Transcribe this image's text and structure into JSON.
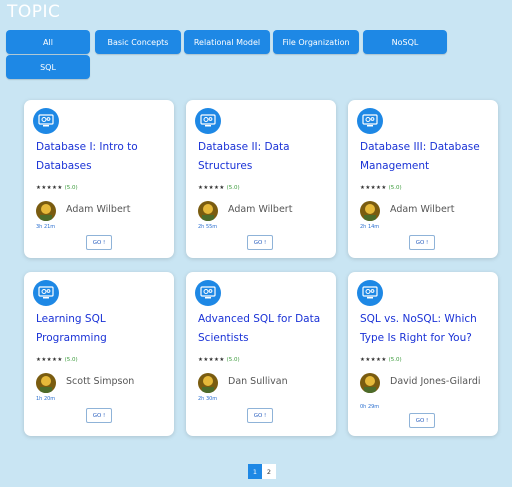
{
  "header": {
    "title": "TOPIC"
  },
  "filters": [
    {
      "label": "All"
    },
    {
      "label": "Basic Concepts"
    },
    {
      "label": "Relational Model"
    },
    {
      "label": "File Organization"
    },
    {
      "label": "NoSQL"
    },
    {
      "label": "SQL"
    }
  ],
  "colors": {
    "accent": "#1e88e5",
    "background": "#c9e5f3",
    "title_link": "#1a32d6"
  },
  "courses": [
    {
      "title": "Database I: Intro to Databases",
      "stars": "★★★★★",
      "score": "(5.0)",
      "author": "Adam Wilbert",
      "duration": "3h 21m",
      "action": "GO !",
      "icon": "gear-monitor-icon"
    },
    {
      "title": "Database II: Data Structures",
      "stars": "★★★★★",
      "score": "(5.0)",
      "author": "Adam Wilbert",
      "duration": "2h 55m",
      "action": "GO !",
      "icon": "gear-monitor-icon"
    },
    {
      "title": "Database III: Database Management",
      "stars": "★★★★★",
      "score": "(5.0)",
      "author": "Adam Wilbert",
      "duration": "2h 14m",
      "action": "GO !",
      "icon": "gear-monitor-icon"
    },
    {
      "title": "Learning SQL Programming",
      "stars": "★★★★★",
      "score": "(5.0)",
      "author": "Scott Simpson",
      "duration": "1h 20m",
      "action": "GO !",
      "icon": "gear-monitor-icon"
    },
    {
      "title": "Advanced SQL for Data Scientists",
      "stars": "★★★★★",
      "score": "(5.0)",
      "author": "Dan Sullivan",
      "duration": "2h 30m",
      "action": "GO !",
      "icon": "gear-monitor-icon"
    },
    {
      "title": "SQL vs. NoSQL: Which Type Is Right for You?",
      "stars": "★★★★★",
      "score": "(5.0)",
      "author": "David Jones-Gilardi",
      "duration": "0h 29m",
      "action": "GO !",
      "icon": "gear-monitor-icon"
    }
  ],
  "pagination": {
    "pages": [
      "1",
      "2"
    ],
    "current": "1"
  }
}
